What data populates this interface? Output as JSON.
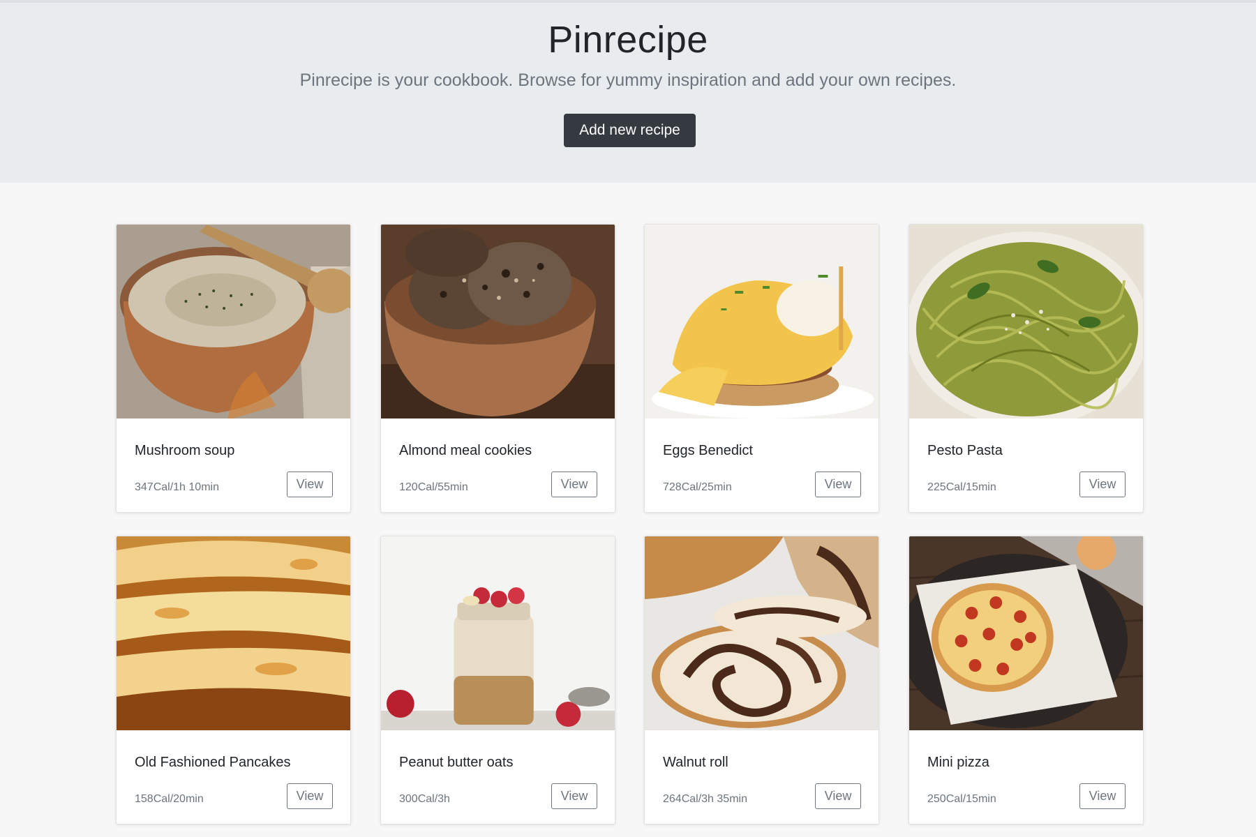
{
  "header": {
    "title": "Pinrecipe",
    "lead": "Pinrecipe is your cookbook. Browse for yummy inspiration and add your own recipes.",
    "add_button": "Add new recipe"
  },
  "recipes": [
    {
      "name": "Mushroom soup",
      "meta": "347Cal/1h 10min",
      "view": "View",
      "image": "mushroom-soup-photo"
    },
    {
      "name": "Almond meal cookies",
      "meta": "120Cal/55min",
      "view": "View",
      "image": "almond-cookies-photo"
    },
    {
      "name": "Eggs Benedict",
      "meta": "728Cal/25min",
      "view": "View",
      "image": "eggs-benedict-photo"
    },
    {
      "name": "Pesto Pasta",
      "meta": "225Cal/15min",
      "view": "View",
      "image": "pesto-pasta-photo"
    },
    {
      "name": "Old Fashioned Pancakes",
      "meta": "158Cal/20min",
      "view": "View",
      "image": "pancakes-photo"
    },
    {
      "name": "Peanut butter oats",
      "meta": "300Cal/3h",
      "view": "View",
      "image": "peanut-butter-oats-photo"
    },
    {
      "name": "Walnut roll",
      "meta": "264Cal/3h 35min",
      "view": "View",
      "image": "walnut-roll-photo"
    },
    {
      "name": "Mini pizza",
      "meta": "250Cal/15min",
      "view": "View",
      "image": "mini-pizza-photo"
    }
  ],
  "colors": {
    "header_bg": "#e9ecef",
    "page_bg": "#f7f7f7",
    "button_dark": "#343a40",
    "muted": "#6c757d"
  }
}
